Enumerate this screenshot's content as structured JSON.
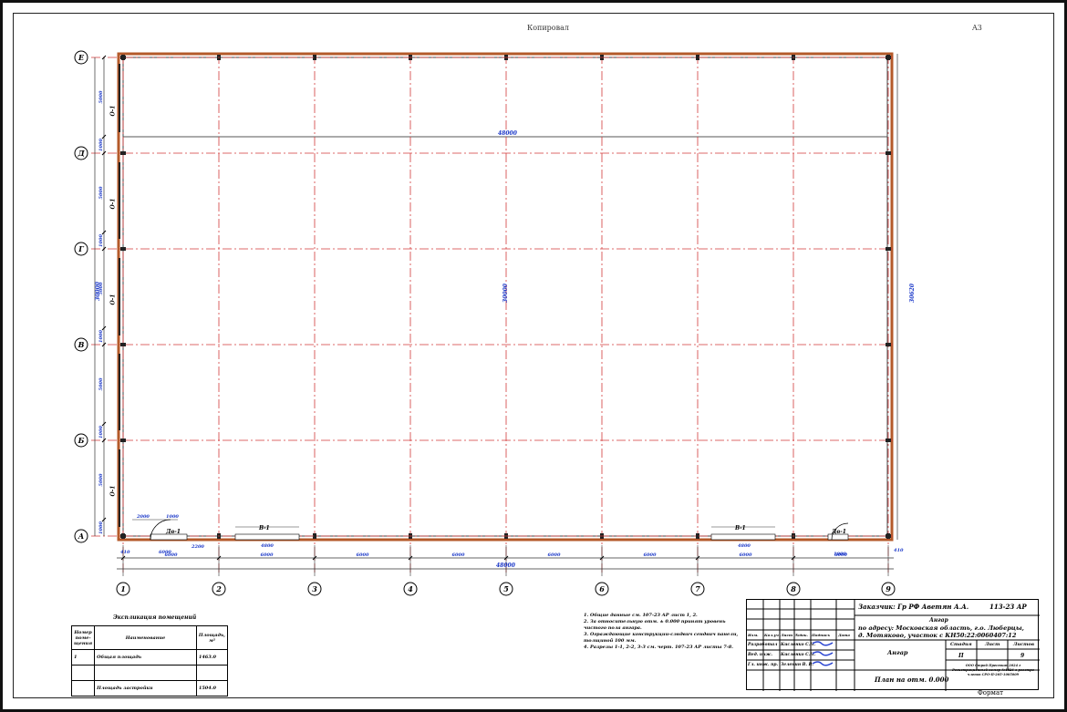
{
  "sheet": {
    "top_center_label": "Копировал",
    "top_right_label": "A3",
    "bottom_right_label": "Формат"
  },
  "plan": {
    "axes_rows": [
      "Е",
      "Д",
      "Г",
      "В",
      "Б",
      "А"
    ],
    "axes_cols": [
      "1",
      "2",
      "3",
      "4",
      "5",
      "6",
      "7",
      "8",
      "9"
    ],
    "overall_width": "48000",
    "overall_height": "30000",
    "bay_dims": [
      "6000",
      "6000",
      "6000",
      "6000",
      "6000",
      "6000",
      "6000",
      "6000"
    ],
    "side_dims": [
      "5000",
      "1000",
      "5000",
      "1000",
      "5000",
      "1000",
      "5000",
      "1000",
      "5000",
      "1000"
    ],
    "left_total": "30000",
    "right_total": "30620",
    "edge_dim_left": "410",
    "edge_dim_right": "410",
    "window_labels": [
      "О-1",
      "О-1",
      "О-1",
      "О-1"
    ],
    "door_labels": [
      "Дв-1",
      "Дв-1"
    ],
    "gate_labels": [
      "В-1",
      "В-1"
    ],
    "door_dims": [
      "2000",
      "1000",
      "2200",
      "4800",
      "4800",
      "1000",
      "1000",
      "6000"
    ]
  },
  "rooms": {
    "title": "Экспликация помещений",
    "headers": [
      "Номер поме- щения",
      "Наименование",
      "Площадь, м²"
    ],
    "rows": [
      {
        "num": "1",
        "name": "Общая площадь",
        "area": "1463.0"
      },
      {
        "num": "",
        "name": "",
        "area": ""
      },
      {
        "num": "",
        "name": "Площадь застройки",
        "area": "1504.0"
      }
    ]
  },
  "notes": [
    "1. Общие данные см. 107-23 АР лист 1, 2.",
    "2. За относительную отм. ± 0.000 принят уровень чистого пола ангара.",
    "3. Ограждающие конструкции-сэндвич сендвич панели, толщиной 100 мм.",
    "4. Разрезы 1-1, 2-2, 3-3 см. черт. 107-23 АР листы 7-8."
  ],
  "stamp": {
    "customer": "Заказчик: Гр РФ Аветян А.А.",
    "code": "113-23 АР",
    "object_title": "Ангар",
    "address1": "по адресу: Московская область, г.о. Люберцы,",
    "address2": "д. Мотяково, участок с КН50:22:0060407:12",
    "building": "Ангар",
    "sheet_title": "План на отм. 0.000",
    "col_stage": "Стадия",
    "col_sheet": "Лист",
    "col_sheets": "Листов",
    "stage": "П",
    "sheet_no": "",
    "sheets_total": "9",
    "org": "ООО Строй Престиж 2024 г Регистрационный номер №4826 в реестре членов СРО-П-205-1005009",
    "cols": [
      "Изм.",
      "Кол.уч",
      "Лист",
      "№док.",
      "Подпись",
      "Дата"
    ],
    "roles": [
      {
        "role": "Разработал",
        "name": "Кисленко С.Н."
      },
      {
        "role": "Вед. инж.",
        "name": "Кисленко С.Н."
      },
      {
        "role": "Гл. инж. пр.",
        "name": "Зеленин В. В."
      }
    ]
  }
}
